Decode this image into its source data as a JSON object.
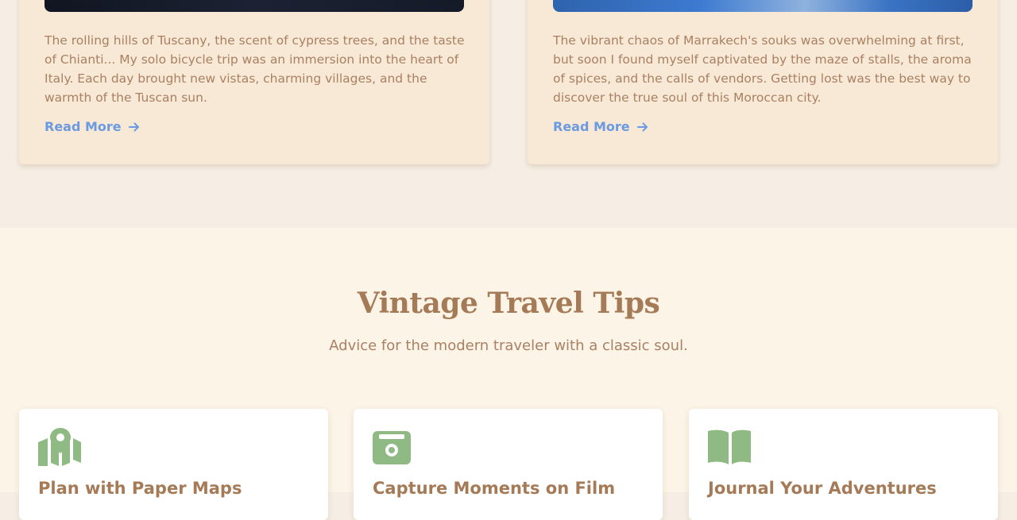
{
  "stories": [
    {
      "text": "The rolling hills of Tuscany, the scent of cypress trees, and the taste of Chianti... My solo bicycle trip was an immersion into the heart of Italy. Each day brought new vistas, charming villages, and the warmth of the Tuscan sun.",
      "read_more": "Read More"
    },
    {
      "text": "The vibrant chaos of Marrakech's souks was overwhelming at first, but soon I found myself captivated by the maze of stalls, the aroma of spices, and the calls of vendors. Getting lost was the best way to discover the true soul of this Moroccan city.",
      "read_more": "Read More"
    }
  ],
  "tips": {
    "title": "Vintage Travel Tips",
    "subtitle": "Advice for the modern traveler with a classic soul.",
    "cards": [
      {
        "icon": "map-icon",
        "title": "Plan with Paper Maps"
      },
      {
        "icon": "camera-icon",
        "title": "Capture Moments on Film"
      },
      {
        "icon": "book-icon",
        "title": "Journal Your Adventures"
      }
    ]
  },
  "colors": {
    "accent_link": "#6b9ae0",
    "icon_green": "#8fba84",
    "heading_brown": "#a57a57",
    "text_brown": "#a98063"
  }
}
